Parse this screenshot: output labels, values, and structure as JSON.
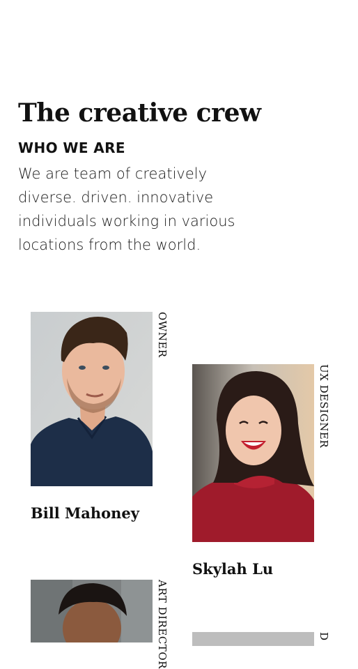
{
  "header": {
    "title": "The creative crew",
    "eyebrow": "WHO WE ARE",
    "intro": "We are team of creatively diverse. driven. innovative individuals working in various locations from the world."
  },
  "team": [
    {
      "name": "Bill Mahoney",
      "role": "OWNER",
      "photo_label": "portrait"
    },
    {
      "name": "Skylah Lu",
      "role": "UX DESIGNER",
      "photo_label": "portrait"
    },
    {
      "name": "",
      "role": "ART DIRECTOR",
      "photo_label": "portrait"
    },
    {
      "name": "",
      "role": "D",
      "photo_label": "portrait"
    }
  ]
}
